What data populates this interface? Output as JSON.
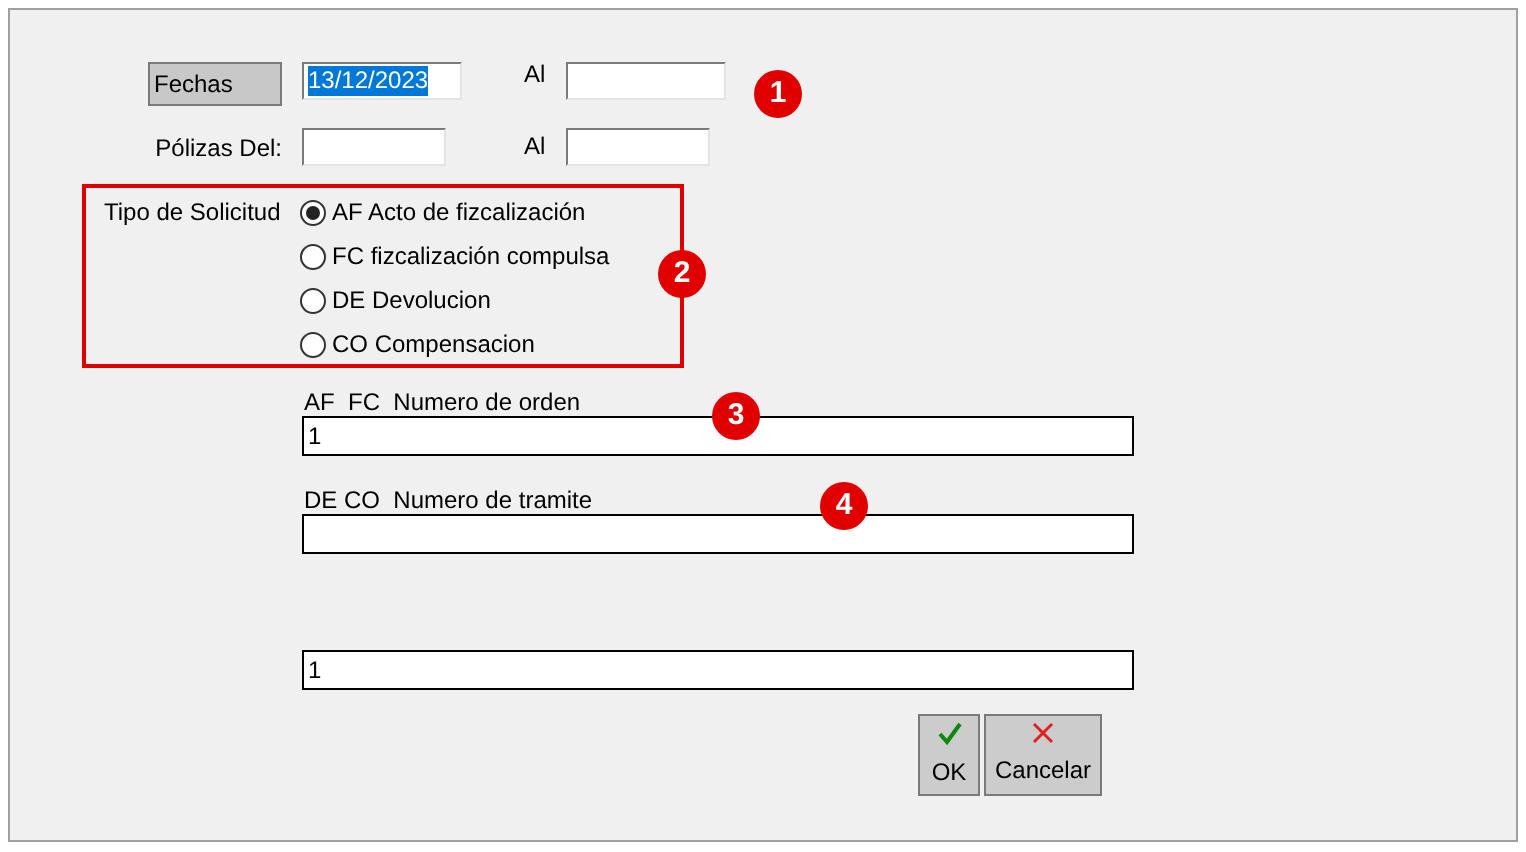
{
  "fechas": {
    "button": "Fechas",
    "value": "13/12/2023",
    "value_selected": true,
    "al_label": "Al"
  },
  "polizas": {
    "label": "Pólizas Del:",
    "al_label": "Al"
  },
  "tipo_solicitud": {
    "label": "Tipo de Solicitud",
    "options": [
      {
        "label": "AF Acto de fizcalización",
        "selected": true
      },
      {
        "label": "FC fizcalización compulsa",
        "selected": false
      },
      {
        "label": "DE Devolucion",
        "selected": false
      },
      {
        "label": "CO Compensacion",
        "selected": false
      }
    ]
  },
  "fields": [
    {
      "label": "AF  FC  Numero de orden",
      "value": "1"
    },
    {
      "label": "DE CO  Numero de tramite"
    },
    {
      "value": "1"
    }
  ],
  "buttons": [
    {
      "kind": "ok",
      "label": "OK"
    },
    {
      "kind": "cancel",
      "label": "Cancelar"
    }
  ],
  "annotations": [
    "1",
    "2",
    "3",
    "4"
  ]
}
